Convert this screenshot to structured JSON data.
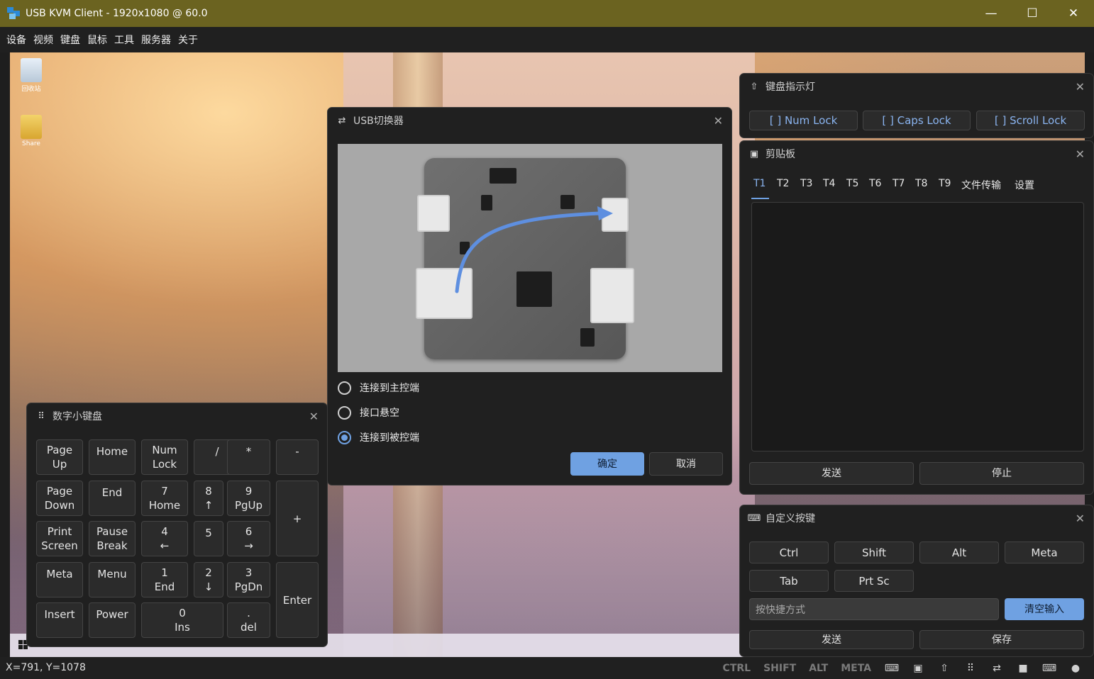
{
  "window": {
    "title": "USB KVM Client - 1920x1080 @ 60.0",
    "minimize": "—",
    "maximize": "☐",
    "close": "✕"
  },
  "menu": [
    "设备",
    "视频",
    "键盘",
    "鼠标",
    "工具",
    "服务器",
    "关于"
  ],
  "desktop": {
    "icons": [
      "回收站",
      "Share"
    ]
  },
  "usb_switch": {
    "title": "USB切换器",
    "options": [
      {
        "label": "连接到主控端",
        "selected": false
      },
      {
        "label": "接口悬空",
        "selected": false
      },
      {
        "label": "连接到被控端",
        "selected": true
      }
    ],
    "ok": "确定",
    "cancel": "取消"
  },
  "numpad": {
    "title": "数字小键盘",
    "keys": {
      "pageup_1": "Page",
      "pageup_2": "Up",
      "home": "Home",
      "numlock_1": "Num",
      "numlock_2": "Lock",
      "slash": "/",
      "star": "*",
      "minus": "-",
      "pagedown_1": "Page",
      "pagedown_2": "Down",
      "end": "End",
      "k7_1": "7",
      "k7_2": "Home",
      "k8_1": "8",
      "k8_2": "↑",
      "k9_1": "9",
      "k9_2": "PgUp",
      "plus": "+",
      "print_1": "Print",
      "print_2": "Screen",
      "pause_1": "Pause",
      "pause_2": "Break",
      "k4_1": "4",
      "k4_2": "←",
      "k5": "5",
      "k6_1": "6",
      "k6_2": "→",
      "meta": "Meta",
      "menu": "Menu",
      "k1_1": "1",
      "k1_2": "End",
      "k2_1": "2",
      "k2_2": "↓",
      "k3_1": "3",
      "k3_2": "PgDn",
      "enter": "Enter",
      "insert": "Insert",
      "power": "Power",
      "k0_1": "0",
      "k0_2": "Ins",
      "dot_1": ".",
      "dot_2": "del"
    }
  },
  "lock_indicator": {
    "title": "键盘指示灯",
    "num": "[ ] Num Lock",
    "caps": "[ ] Caps Lock",
    "scroll": "[ ] Scroll Lock"
  },
  "clipboard": {
    "title": "剪贴板",
    "tabs": [
      "T1",
      "T2",
      "T3",
      "T4",
      "T5",
      "T6",
      "T7",
      "T8",
      "T9",
      "文件传输",
      "设置"
    ],
    "active_tab": "T1",
    "send": "发送",
    "stop": "停止"
  },
  "custom_keys": {
    "title": "自定义按键",
    "keys": [
      "Ctrl",
      "Shift",
      "Alt",
      "Meta",
      "Tab",
      "Prt Sc"
    ],
    "placeholder": "按快捷方式",
    "clear": "清空输入",
    "send": "发送",
    "save": "保存"
  },
  "status": {
    "coords": "X=791, Y=1078",
    "modifiers": [
      "CTRL",
      "SHIFT",
      "ALT",
      "META"
    ]
  },
  "colors": {
    "titlebar": "#6b6320",
    "accent": "#6fa1e2",
    "panel_bg": "#202020"
  }
}
